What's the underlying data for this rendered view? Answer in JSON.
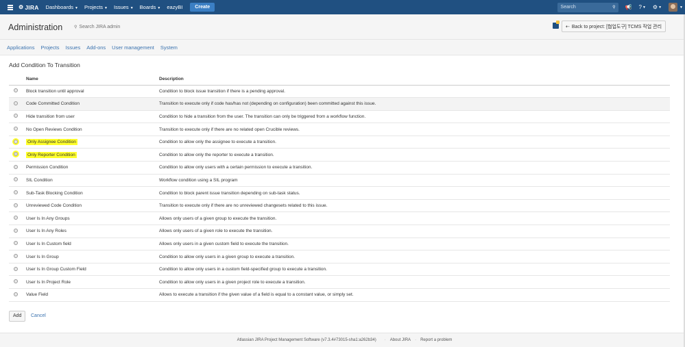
{
  "topnav": {
    "logo": "JIRA",
    "menu": [
      {
        "label": "Dashboards",
        "dropdown": true
      },
      {
        "label": "Projects",
        "dropdown": true
      },
      {
        "label": "Issues",
        "dropdown": true
      },
      {
        "label": "Boards",
        "dropdown": true
      },
      {
        "label": "eazyBI",
        "dropdown": false
      }
    ],
    "create_label": "Create",
    "search_placeholder": "Search",
    "icons": [
      "hamburger-icon",
      "jira-logo-icon",
      "search-icon",
      "notifications-icon",
      "help-icon",
      "settings-icon",
      "avatar"
    ]
  },
  "admin": {
    "title": "Administration",
    "search_label": "Search JIRA admin",
    "back_button": "Back to project: [협업도구] TCMS 작업 관리"
  },
  "tabs": [
    "Applications",
    "Projects",
    "Issues",
    "Add-ons",
    "User management",
    "System"
  ],
  "page": {
    "section_title": "Add Condition To Transition",
    "col_name": "Name",
    "col_description": "Description",
    "conditions": [
      {
        "name": "Block transition until approval",
        "description": "Condition to block issue transition if there is a pending approval.",
        "selected": false,
        "highlight": false
      },
      {
        "name": "Code Committed Condition",
        "description": "Transition to execute only if code has/has not (depending on configuration) been committed against this issue.",
        "selected": false,
        "highlight": false
      },
      {
        "name": "Hide transition from user",
        "description": "Condition to hide a transition from the user. The transition can only be triggered from a workflow function.",
        "selected": false,
        "highlight": false
      },
      {
        "name": "No Open Reviews Condition",
        "description": "Transition to execute only if there are no related open Crucible reviews.",
        "selected": false,
        "highlight": false
      },
      {
        "name": "Only Assignee Condition",
        "description": "Condition to allow only the assignee to execute a transition.",
        "selected": false,
        "highlight": true
      },
      {
        "name": "Only Reporter Condition",
        "description": "Condition to allow only the reporter to execute a transition.",
        "selected": true,
        "highlight": true
      },
      {
        "name": "Permission Condition",
        "description": "Condition to allow only users with a certain permission to execute a transition.",
        "selected": false,
        "highlight": false
      },
      {
        "name": "SIL Condition",
        "description": "Workflow condition using a SIL program",
        "selected": false,
        "highlight": false
      },
      {
        "name": "Sub-Task Blocking Condition",
        "description": "Condition to block parent issue transition depending on sub-task status.",
        "selected": false,
        "highlight": false
      },
      {
        "name": "Unreviewed Code Condition",
        "description": "Transition to execute only if there are no unreviewed changesets related to this issue.",
        "selected": false,
        "highlight": false
      },
      {
        "name": "User Is In Any Groups",
        "description": "Allows only users of a given group to execute the transition.",
        "selected": false,
        "highlight": false
      },
      {
        "name": "User Is In Any Roles",
        "description": "Allows only users of a given role to execute the transition.",
        "selected": false,
        "highlight": false
      },
      {
        "name": "User Is In Custom field",
        "description": "Allows only users in a given custom field to execute the transition.",
        "selected": false,
        "highlight": false
      },
      {
        "name": "User Is In Group",
        "description": "Condition to allow only users in a given group to execute a transition.",
        "selected": false,
        "highlight": false
      },
      {
        "name": "User Is In Group Custom Field",
        "description": "Condition to allow only users in a custom field-specified group to execute a transition.",
        "selected": false,
        "highlight": false
      },
      {
        "name": "User Is In Project Role",
        "description": "Condition to allow only users in a given project role to execute a transition.",
        "selected": false,
        "highlight": false
      },
      {
        "name": "Value Field",
        "description": "Allows to execute a transition if the given value of a field is equal to a constant value, or simply set.",
        "selected": false,
        "highlight": false
      }
    ],
    "add_label": "Add",
    "cancel_label": "Cancel"
  },
  "footer": {
    "version": "Atlassian JIRA Project Management Software (v7.3.4#73015-sha1:a262b34)",
    "about": "About JIRA",
    "report": "Report a problem"
  },
  "colors": {
    "topnav_bg": "#205081",
    "link": "#3b73af",
    "highlight": "#ffff2a",
    "create_button": "#3b7fc4"
  }
}
